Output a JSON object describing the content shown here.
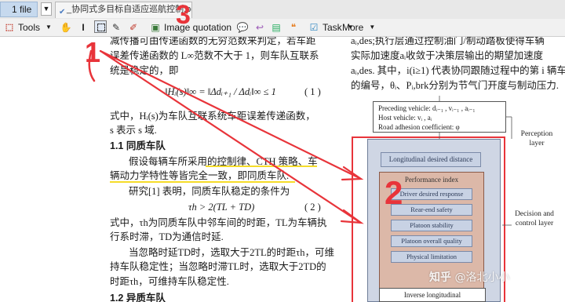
{
  "tabs": {
    "files_label": "1 file",
    "doc_name": "_协同式多目标自适应巡航控制.pdf"
  },
  "toolbar": {
    "tools_label": "Tools",
    "image_quotation_label": "Image quotation",
    "task_label": "Task",
    "more_label": "More"
  },
  "annotations": {
    "num1": "1",
    "num2": "2",
    "num3": "3",
    "accent_color": "#e8343a",
    "highlight_color": "#f5dc2a"
  },
  "left_column": {
    "line1": "减传播可由传递函数的无穷范数来判定，若车距",
    "line2": "误差传递函数的 L∞范数不大于 1，则车队互联系",
    "line3": "统是稳定的，即",
    "eq1": "‖Hᵢ(s)‖∞ = ‖Δdᵢ₊₁ / Δdᵢ‖∞ ≤ 1",
    "eq1_num": "( 1 )",
    "line4": "式中，Hᵢ(s)为车队互联系统车距误差传递函数，",
    "line5": "s 表示 s 域.",
    "sec11": "1.1   同质车队",
    "line6": "假设每辆车所采用的控制律、CTH 策略、车",
    "line7": "辆动力学特性等皆完全一致，即同质车队.",
    "line8": "研究[1] 表明，同质车队稳定的条件为",
    "eq2": "τh > 2(TL + TD)",
    "eq2_num": "( 2 )",
    "line9": "式中，τh为同质车队中邻车间的时距，TL为车辆执",
    "line10": "行系时滞，TD为通信时延.",
    "line11": "当忽略时延TD时，选取大于2TL的时距τh，可维",
    "line12": "持车队稳定性；当忽略时滞TL时，选取大于2TD的",
    "line13": "时距τh，可维持车队稳定性.",
    "sec12": "1.2   异质车队"
  },
  "right_column": {
    "line1": "aᵢ,des;执行层通过控制油门/制动踏板使得车辆",
    "line2": "实际加速度aᵢ收敛于决策层输出的期望加速度",
    "line3": "aᵢ,des. 其中，i(i≥1) 代表协同跟随过程中的第 i 辆车",
    "line4": "的编号，θᵢ、Pᵢ,brk分别为节气门开度与制动压力."
  },
  "diagram": {
    "preceding": "Preceding vehicle: dᵢ₋₁ , vᵢ₋₁ , aᵢ₋₁",
    "host": "Host vehicle: vᵢ , aᵢ",
    "road": "Road adhesion coefficient: φ",
    "ldd": "Longitudinal desired distance",
    "pi_title": "Performance index",
    "pi_items": [
      "Driver desired response",
      "Rear-end safety",
      "Platoon stability",
      "Platoon overall quality",
      "Physical limitation"
    ],
    "inverse": "Inverse longitudinal",
    "perception_label": "Perception layer",
    "decision_label": "Decision and control layer"
  },
  "watermark": {
    "logo": "知乎",
    "handle": "@洛北小小"
  }
}
